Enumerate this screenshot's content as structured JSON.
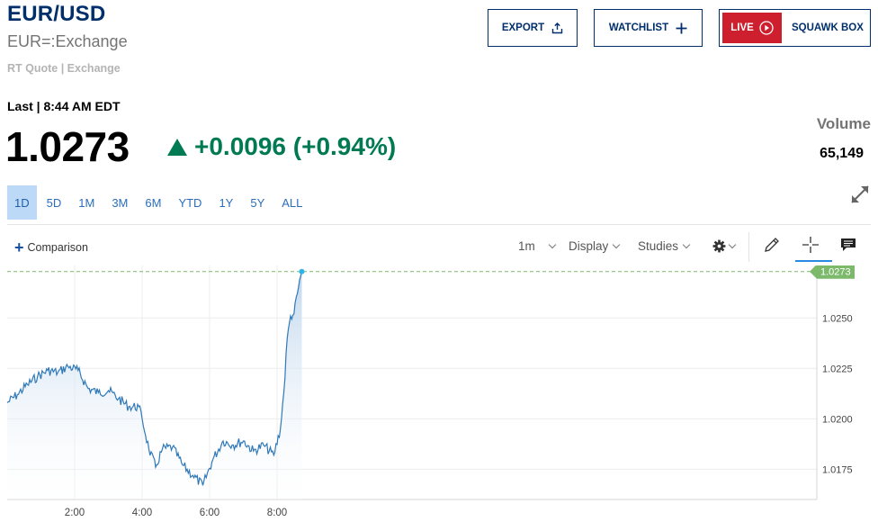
{
  "header": {
    "symbol": "EUR/USD",
    "name": "EUR=:Exchange",
    "source": "RT Quote | Exchange"
  },
  "actions": {
    "export_label": "EXPORT",
    "watchlist_label": "WATCHLIST",
    "live_label": "LIVE",
    "squawk_label": "SQUAWK BOX"
  },
  "quote": {
    "last_label": "Last | 8:44 AM EDT",
    "price": "1.0273",
    "change": "+0.0096 (+0.94%)",
    "volume_label": "Volume",
    "volume_value": "65,149"
  },
  "ranges": [
    "1D",
    "5D",
    "1M",
    "3M",
    "6M",
    "YTD",
    "1Y",
    "5Y",
    "ALL"
  ],
  "active_range": "1D",
  "toolbar": {
    "comparison_label": "Comparison",
    "interval_label": "1m",
    "display_label": "Display",
    "studies_label": "Studies"
  },
  "icons": [
    "export-icon",
    "plus-icon",
    "play-circle-icon",
    "expand-icon",
    "gear-icon",
    "pencil-icon",
    "crosshair-icon",
    "comment-icon"
  ],
  "colors": {
    "navy": "#002f6c",
    "positive": "#007a52",
    "live_red": "#cd1f2d",
    "line": "#2f79b9",
    "area_top": "#bdd5ec",
    "last_price_tag": "#7cb96b",
    "active_range_bg": "#bcd9f7"
  },
  "chart_data": {
    "type": "area",
    "y_axis_position": "right",
    "grid": true,
    "x_ticks": [
      "2:00",
      "4:00",
      "6:00",
      "8:00"
    ],
    "y_ticks": [
      "1.0175",
      "1.0200",
      "1.0225",
      "1.0250"
    ],
    "last_price_label": "1.0273",
    "xlim": [
      0.0,
      24.0
    ],
    "ylim": [
      1.016,
      1.0276
    ],
    "x_hours": [
      0.0,
      0.3,
      0.6,
      0.9,
      1.2,
      1.5,
      1.8,
      2.1,
      2.4,
      2.7,
      3.0,
      3.3,
      3.6,
      3.9,
      4.0,
      4.2,
      4.4,
      4.6,
      4.9,
      5.2,
      5.5,
      5.8,
      6.1,
      6.4,
      6.7,
      7.0,
      7.3,
      7.6,
      7.9,
      8.1,
      8.2,
      8.3,
      8.4,
      8.5,
      8.6,
      8.733
    ],
    "y_values": [
      1.0208,
      1.0212,
      1.0217,
      1.0221,
      1.0224,
      1.0223,
      1.0226,
      1.0224,
      1.0215,
      1.0213,
      1.0214,
      1.021,
      1.0206,
      1.0206,
      1.02,
      1.0185,
      1.0176,
      1.0185,
      1.0186,
      1.0177,
      1.0172,
      1.0167,
      1.018,
      1.0189,
      1.0187,
      1.0189,
      1.0184,
      1.0187,
      1.0182,
      1.0195,
      1.0213,
      1.024,
      1.0251,
      1.0252,
      1.0262,
      1.0273
    ]
  }
}
